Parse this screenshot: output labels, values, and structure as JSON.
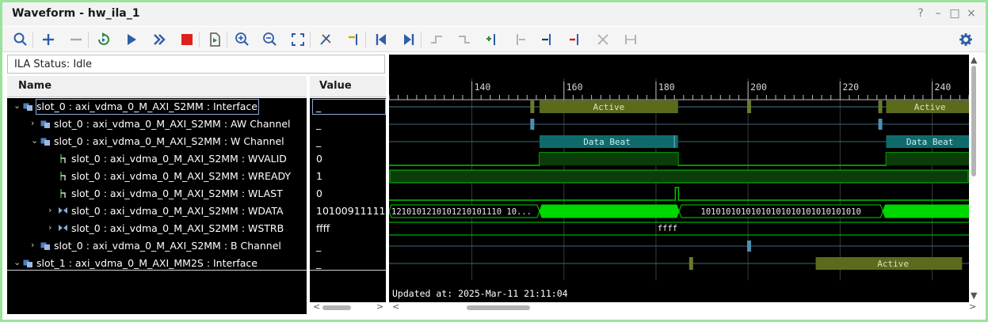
{
  "window": {
    "title": "Waveform - hw_ila_1",
    "controls": [
      "?",
      "–",
      "□",
      "×"
    ]
  },
  "toolbar": {
    "buttons": [
      {
        "icon": "search-icon"
      },
      {
        "icon": "add-icon"
      },
      {
        "icon": "remove-icon"
      },
      {
        "icon": "run-trigger-immediate-icon"
      },
      {
        "icon": "run-trigger-icon"
      },
      {
        "icon": "auto-rearm-icon"
      },
      {
        "icon": "stop-icon"
      },
      {
        "icon": "export-icon"
      },
      {
        "icon": "zoom-in-icon"
      },
      {
        "icon": "zoom-out-icon"
      },
      {
        "icon": "zoom-fit-icon"
      },
      {
        "icon": "cursor-to-zero-icon"
      },
      {
        "icon": "go-to-time-icon"
      },
      {
        "icon": "go-to-start-icon"
      },
      {
        "icon": "go-to-end-icon"
      },
      {
        "icon": "previous-transition-icon"
      },
      {
        "icon": "next-transition-icon"
      },
      {
        "icon": "add-marker-icon"
      },
      {
        "icon": "previous-marker-icon"
      },
      {
        "icon": "next-marker-icon"
      },
      {
        "icon": "delete-marker-icon"
      },
      {
        "icon": "swap-cursors-icon"
      },
      {
        "icon": "snap-icon"
      },
      {
        "icon": "settings-gear-icon"
      }
    ]
  },
  "status": {
    "label": "ILA Status: Idle"
  },
  "headers": {
    "name": "Name",
    "value": "Value"
  },
  "signals": [
    {
      "label": "slot_0 : axi_vdma_0_M_AXI_S2MM : Interface",
      "value": "_",
      "icon": "interface-icon",
      "expand": "expanded"
    },
    {
      "label": "slot_0 : axi_vdma_0_M_AXI_S2MM : AW Channel",
      "value": "_",
      "icon": "channel-icon",
      "expand": "collapsed"
    },
    {
      "label": "slot_0 : axi_vdma_0_M_AXI_S2MM : W Channel",
      "value": "_",
      "icon": "channel-icon",
      "expand": "expanded"
    },
    {
      "label": "slot_0 : axi_vdma_0_M_AXI_S2MM : WVALID",
      "value": "0",
      "icon": "signal-icon",
      "expand": "none"
    },
    {
      "label": "slot_0 : axi_vdma_0_M_AXI_S2MM : WREADY",
      "value": "1",
      "icon": "signal-icon",
      "expand": "none"
    },
    {
      "label": "slot_0 : axi_vdma_0_M_AXI_S2MM : WLAST",
      "value": "0",
      "icon": "signal-icon",
      "expand": "none"
    },
    {
      "label": "slot_0 : axi_vdma_0_M_AXI_S2MM : WDATA",
      "value": "10100911111",
      "icon": "bus-icon",
      "expand": "collapsed"
    },
    {
      "label": "slot_0 : axi_vdma_0_M_AXI_S2MM : WSTRB",
      "value": "ffff",
      "icon": "bus-icon",
      "expand": "collapsed"
    },
    {
      "label": "slot_0 : axi_vdma_0_M_AXI_S2MM : B Channel",
      "value": "_",
      "icon": "channel-icon",
      "expand": "collapsed"
    },
    {
      "label": "slot_1 : axi_vdma_0_M_AXI_MM2S : Interface",
      "value": "_",
      "icon": "interface-icon",
      "expand": "expanded"
    }
  ],
  "timeline": {
    "ticks": [
      "140",
      "160",
      "180",
      "200",
      "220",
      "240"
    ],
    "tick_values": [
      140,
      160,
      180,
      200,
      220,
      240
    ],
    "range": [
      122,
      248
    ]
  },
  "waveform": {
    "active_label": "Active",
    "data_beat_label": "Data Beat",
    "wdata_text_1": "1210101210101210101110 10...",
    "wdata_text_2": "10101010101010101010101010101010",
    "wstrb_text": "ffff",
    "updated_text": "Updated at:  2025-Mar-11 21:11:04",
    "colors": {
      "active_fill": "#5a6b1c",
      "data_beat_fill": "#0f6b6b",
      "signal_green": "#00c400",
      "bus_green": "#00d600",
      "pulse_blue": "#4c8fb0",
      "marker_olive": "#6c7a2c"
    }
  }
}
